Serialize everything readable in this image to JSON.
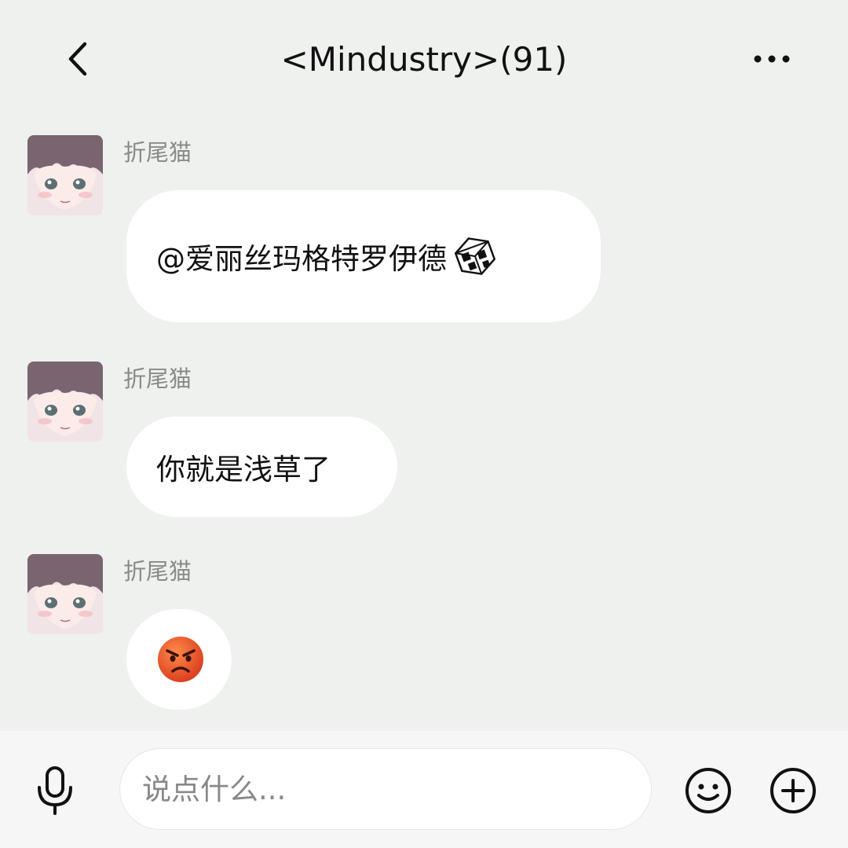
{
  "header": {
    "title": "<Mindustry>(91)",
    "back_icon": "chevron-left-icon",
    "more_icon": "more-horizontal-icon"
  },
  "messages": [
    {
      "sender": "折尾猫",
      "text": "@爱丽丝玛格特罗伊德",
      "trailing_icon": "cube-emoji-icon"
    },
    {
      "sender": "折尾猫",
      "text": "你就是浅草了"
    },
    {
      "sender": "折尾猫",
      "emoji": "angry-face-emoji-icon"
    }
  ],
  "input_bar": {
    "placeholder": "说点什么...",
    "value": "",
    "mic_icon": "microphone-icon",
    "emoji_icon": "smiley-icon",
    "plus_icon": "plus-circle-icon"
  },
  "colors": {
    "background": "#eef1ee",
    "bubble": "#ffffff",
    "sender_name": "#8a8a8a",
    "input_bar": "#f6f6f6",
    "angry_emoji": "#e8502a"
  }
}
